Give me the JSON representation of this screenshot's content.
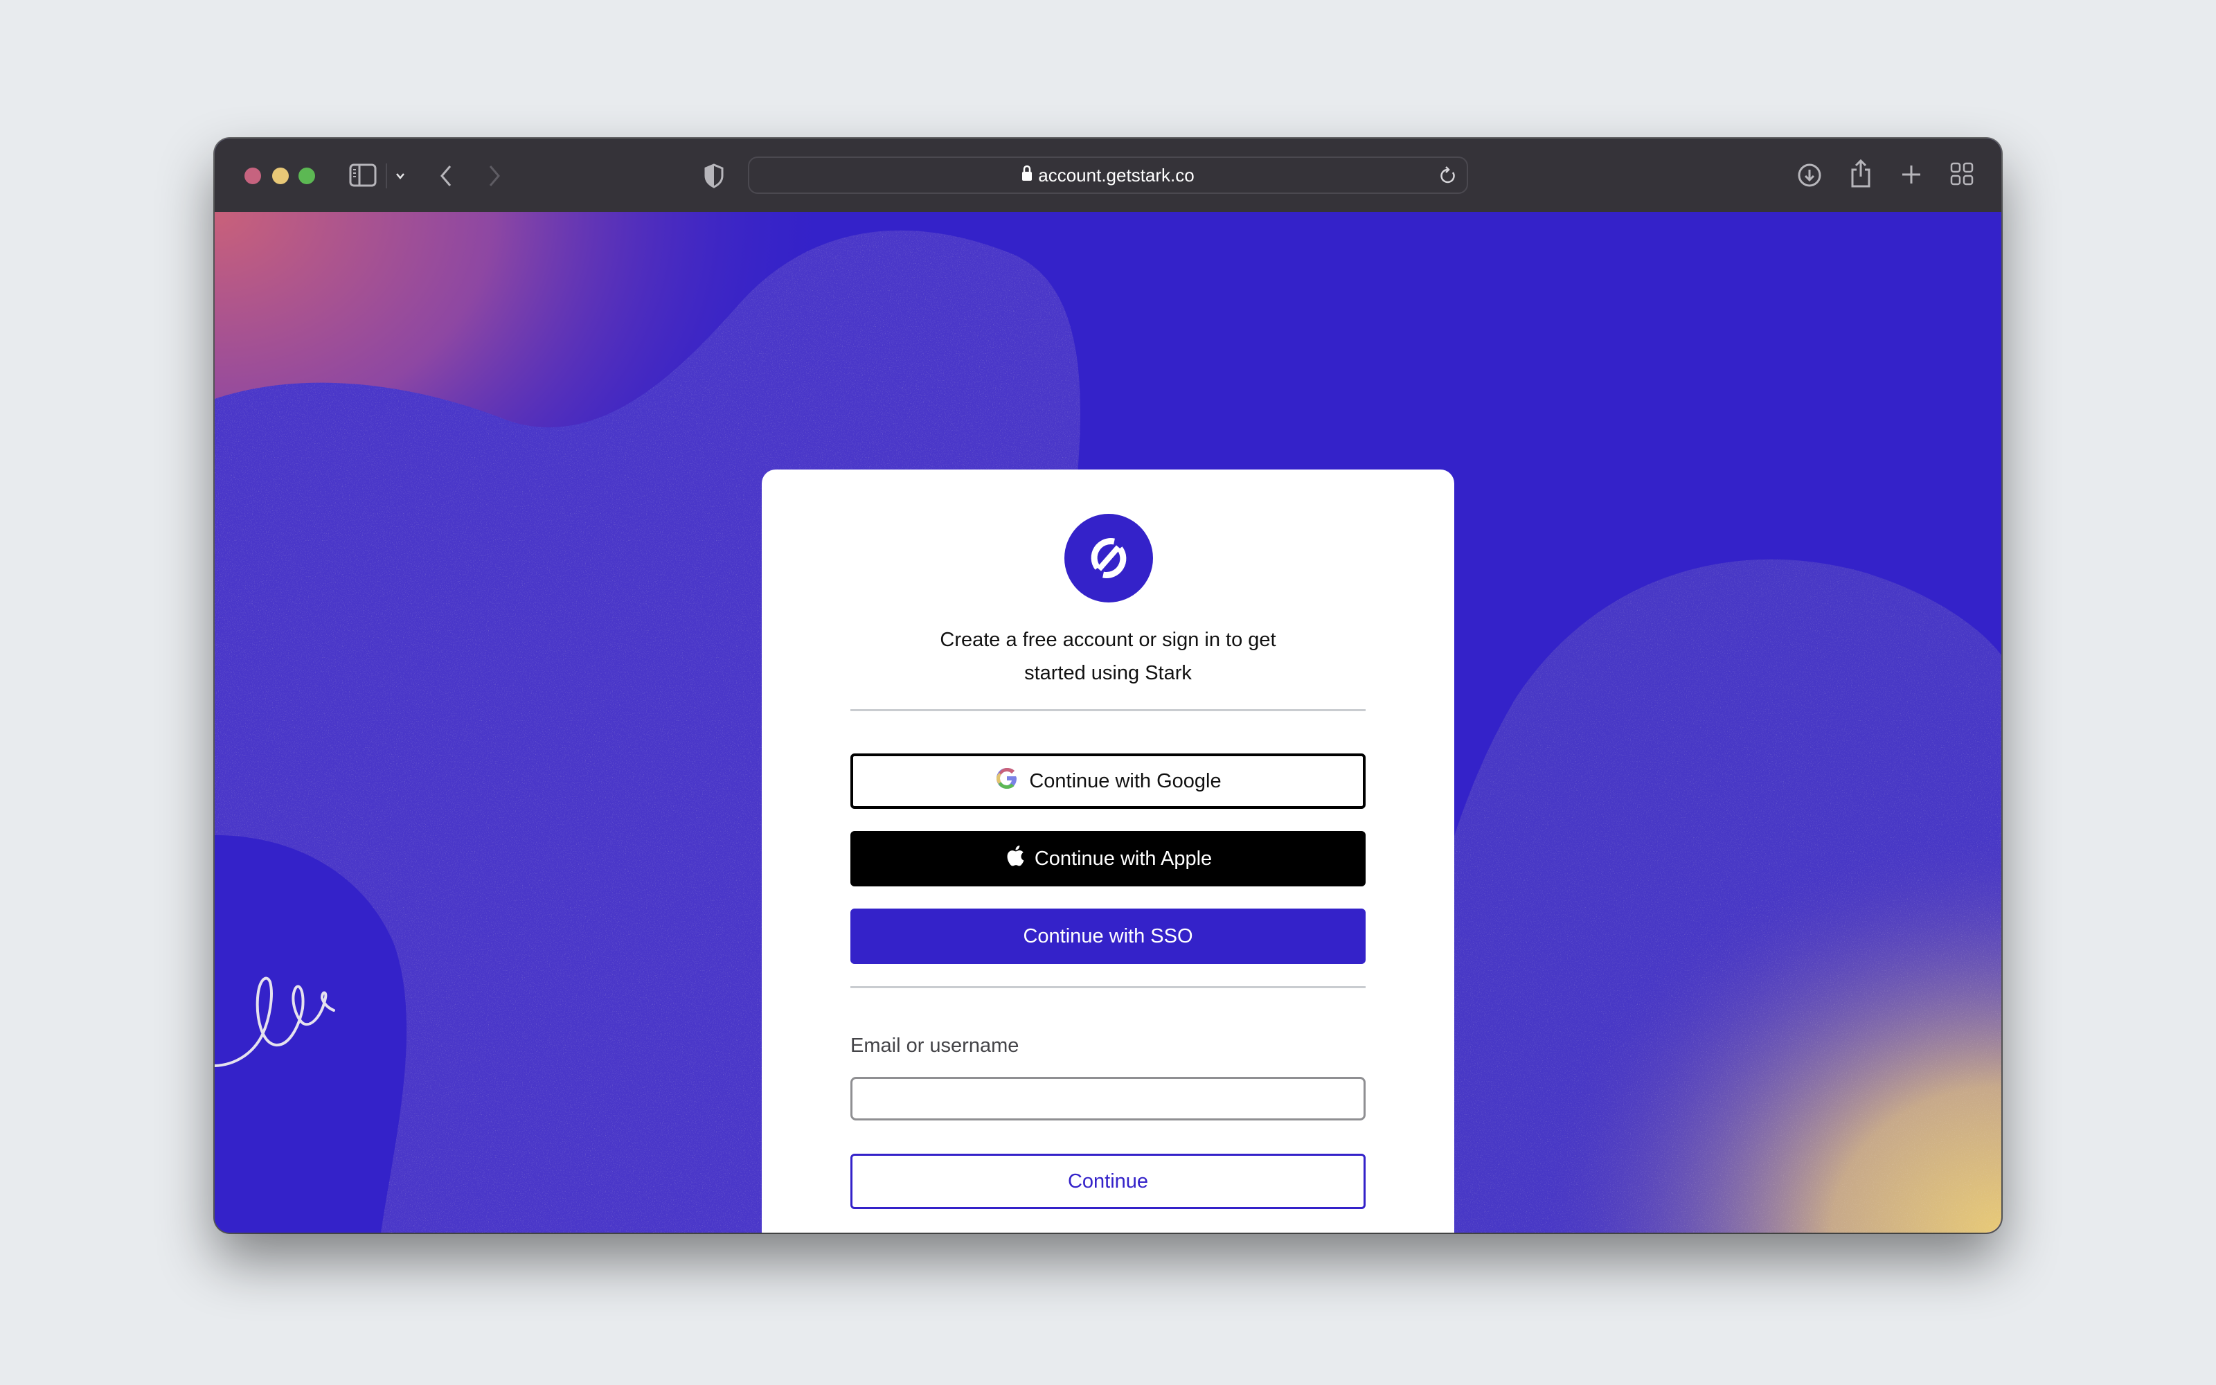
{
  "browser": {
    "url": "account.getstark.co",
    "icons": {
      "sidebar": "sidebar-icon",
      "sidebar_menu": "chevron-down-icon",
      "back": "chevron-left-icon",
      "forward": "chevron-right-icon",
      "privacy": "shield-icon",
      "lock": "lock-icon",
      "reload": "reload-icon",
      "downloads": "download-icon",
      "share": "share-icon",
      "new_tab": "plus-icon",
      "tab_overview": "grid-icon"
    }
  },
  "login": {
    "logo": "stark-logo",
    "intro_line1": "Create a free account or sign in to get",
    "intro_line2": "started using Stark",
    "google_label": "Continue with Google",
    "apple_label": "Continue with Apple",
    "sso_label": "Continue with SSO",
    "email_label": "Email or username",
    "email_value": "",
    "email_placeholder": "",
    "continue_label": "Continue"
  },
  "colors": {
    "brand": "#3422c9",
    "toolbar": "#353339",
    "page_bg": "#e8ebee"
  }
}
